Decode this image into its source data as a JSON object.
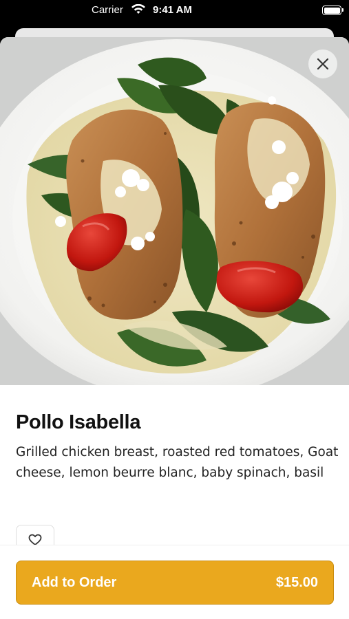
{
  "status_bar": {
    "carrier": "Carrier",
    "time": "9:41 AM"
  },
  "item": {
    "name": "Pollo Isabella",
    "description": "Grilled chicken breast, roasted red tomatoes, Goat cheese, lemon beurre blanc, baby spinach, basil"
  },
  "order_button": {
    "label": "Add to Order",
    "price": "$15.00"
  },
  "colors": {
    "accent": "#eaa81e",
    "accent_border": "#c98d10"
  },
  "icons": {
    "close": "close-icon",
    "favorite": "heart-icon",
    "wifi": "wifi-icon",
    "battery": "battery-icon"
  }
}
